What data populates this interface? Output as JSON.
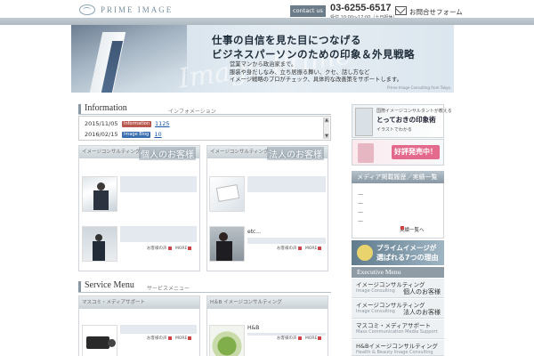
{
  "header": {
    "logo_text": "PRIME IMAGE",
    "contact_label": "contact us",
    "phone": "03-6255-6517",
    "hours": "受付 10:00〜17:00（土日祝休）",
    "form_label": "お問合せフォーム"
  },
  "hero": {
    "script": "Image Prime",
    "headline1": "仕事の自信を見た目につなげる",
    "headline2": "ビジネスパーソンのための印象＆外見戦略",
    "body": "営業マンから政治家まで。\n服装や身だしなみ、立ち居振る舞い、クセ、話し方など\nイメージ戦略のプロがチェック、具体的な改善策をサポートします。",
    "caption": "Prime Image Consulting from Tokyo"
  },
  "information": {
    "title": "Information",
    "subtitle": "インフォメーション",
    "rows": [
      {
        "date": "2015/11/05",
        "tag": "Information",
        "link": "1125"
      },
      {
        "date": "2016/02/15",
        "tag": "Image Blog",
        "link": "10"
      }
    ]
  },
  "cards_top": [
    {
      "sub": "イメージコンサルティング",
      "title": "個人のお客様",
      "etc": "",
      "voice": "お客様の声",
      "more": "MORE"
    },
    {
      "sub": "イメージコンサルティング",
      "title": "法人のお客様",
      "etc": "etc...",
      "voice": "お客様の声",
      "more": "MORE"
    }
  ],
  "service": {
    "title": "Service Menu",
    "subtitle": "サービスメニュー"
  },
  "cards_bottom": [
    {
      "sub": "マスコミ・メディアサポート",
      "title": "",
      "etc": "",
      "voice": "お客様の声",
      "more": "MORE"
    },
    {
      "sub": "H＆B イメージコンサルティング",
      "title": "",
      "etc": "H&B",
      "voice": "お客様の声",
      "more": "MORE"
    }
  ],
  "sidebar": {
    "banner1_top": "国際イメージコンサルタントが教える",
    "banner1_main": "とっておきの印象術",
    "banner1_small": "イラストでわかる",
    "banner1_sale": "好評発売中！",
    "media_title": "メディア掲載履歴／実績一覧",
    "media_items": [
      "—",
      "—",
      "—",
      "—"
    ],
    "more": "実績一覧へ",
    "reason_l1": "プライムイメージが",
    "reason_l2": "選ばれる7つの理由",
    "exec_title": "Executive Menu",
    "exec_items": [
      {
        "main": "イメージコンサルティング",
        "sub": "Image Consulting",
        "jp": "個人のお客様"
      },
      {
        "main": "イメージコンサルティング",
        "sub": "Image Consulting",
        "jp": "法人のお客様"
      },
      {
        "main": "マスコミ・メディアサポート",
        "sub": "Mass Communication Media Support",
        "jp": ""
      },
      {
        "main": "H&Bイメージコンサルティング",
        "sub": "Health & Beauty Image Consulting",
        "jp": ""
      }
    ]
  },
  "colors": {
    "accent": "#8a97a2",
    "link": "#1a57a6",
    "tag_red": "#b8584f",
    "tag_blue": "#3a6fb0"
  }
}
